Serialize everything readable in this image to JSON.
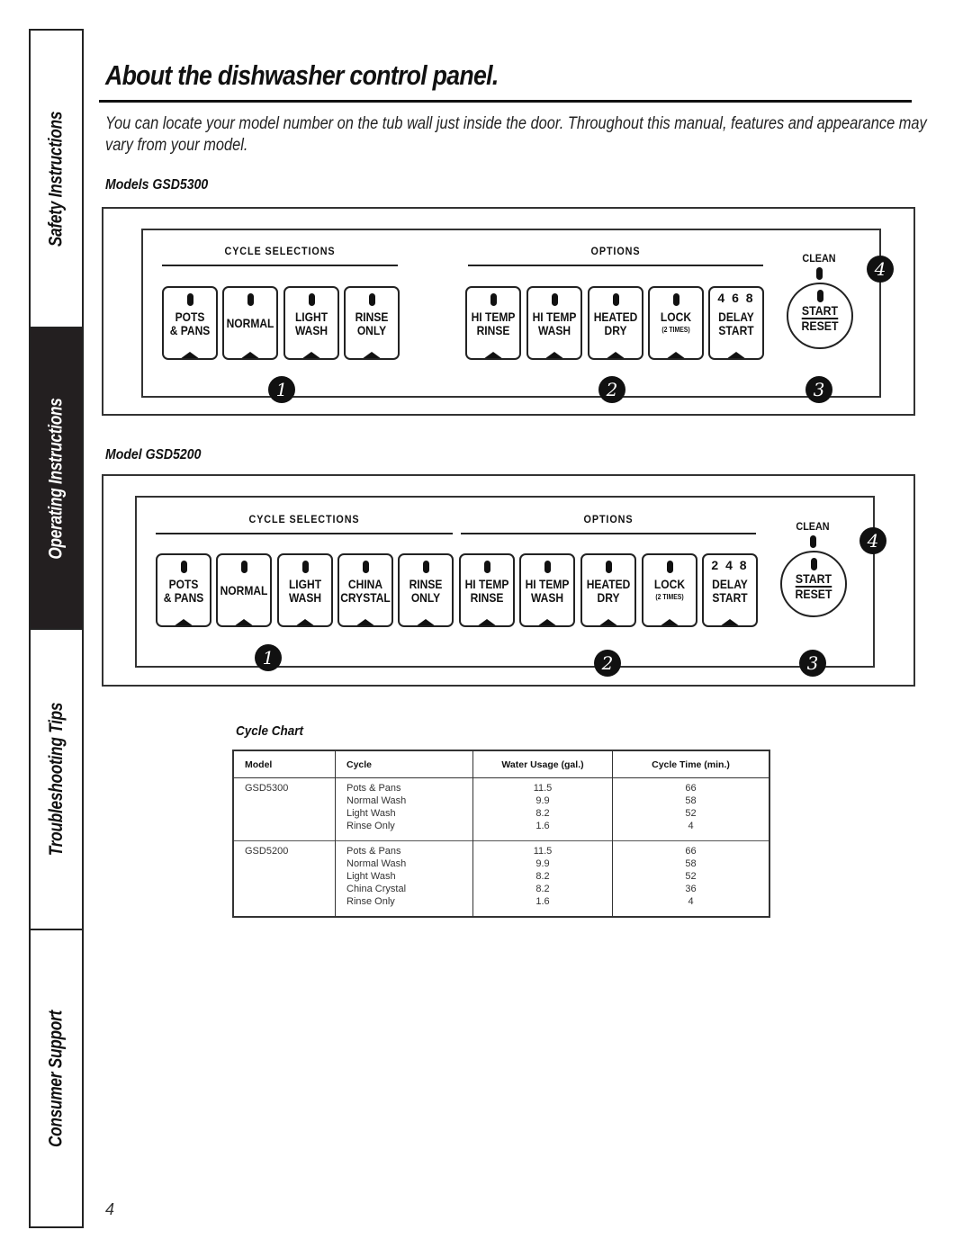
{
  "sidebar": {
    "tabs": [
      {
        "label": "Safety Instructions",
        "active": false
      },
      {
        "label": "Operating Instructions",
        "active": true
      },
      {
        "label": "Troubleshooting Tips",
        "active": false
      },
      {
        "label": "Consumer Support",
        "active": false
      }
    ]
  },
  "header": {
    "title": "About the dishwasher control panel.",
    "intro": "You can locate your model number on the tub wall just inside the door. Throughout this manual, features and appearance may vary from your model."
  },
  "panels": [
    {
      "heading": "Models GSD5300",
      "cycle_label": "CYCLE SELECTIONS",
      "options_label": "OPTIONS",
      "clean_label": "CLEAN",
      "cycle_keys": [
        {
          "line1": "POTS",
          "line2": "& PANS"
        },
        {
          "line1": "NORMAL",
          "line2": ""
        },
        {
          "line1": "LIGHT",
          "line2": "WASH"
        },
        {
          "line1": "RINSE",
          "line2": "ONLY"
        }
      ],
      "option_keys": [
        {
          "line1": "HI TEMP",
          "line2": "RINSE"
        },
        {
          "line1": "HI TEMP",
          "line2": "WASH"
        },
        {
          "line1": "HEATED",
          "line2": "DRY"
        },
        {
          "line1": "LOCK",
          "line2": "(2 TIMES)"
        },
        {
          "line1": "DELAY",
          "line2": "START",
          "hours": "4 6 8"
        }
      ],
      "start": {
        "line1": "START",
        "line2": "RESET"
      },
      "callouts": [
        "1",
        "2",
        "3",
        "4"
      ]
    },
    {
      "heading": "Model GSD5200",
      "cycle_label": "CYCLE SELECTIONS",
      "options_label": "OPTIONS",
      "clean_label": "CLEAN",
      "cycle_keys": [
        {
          "line1": "POTS",
          "line2": "& PANS"
        },
        {
          "line1": "NORMAL",
          "line2": ""
        },
        {
          "line1": "LIGHT",
          "line2": "WASH"
        },
        {
          "line1": "CHINA",
          "line2": "CRYSTAL"
        },
        {
          "line1": "RINSE",
          "line2": "ONLY"
        }
      ],
      "option_keys": [
        {
          "line1": "HI TEMP",
          "line2": "RINSE"
        },
        {
          "line1": "HI TEMP",
          "line2": "WASH"
        },
        {
          "line1": "HEATED",
          "line2": "DRY"
        },
        {
          "line1": "LOCK",
          "line2": "(2 TIMES)"
        },
        {
          "line1": "DELAY",
          "line2": "START",
          "hours": "2 4 8"
        }
      ],
      "start": {
        "line1": "START",
        "line2": "RESET"
      },
      "callouts": [
        "1",
        "2",
        "3",
        "4"
      ]
    }
  ],
  "cycle_chart": {
    "title": "Cycle Chart",
    "columns": [
      "Model",
      "Cycle",
      "Water Usage (gal.)",
      "Cycle Time (min.)"
    ],
    "groups": [
      {
        "model": "GSD5300",
        "rows": [
          {
            "cycle": "Pots & Pans",
            "water": "11.5",
            "time": "66"
          },
          {
            "cycle": "Normal Wash",
            "water": "9.9",
            "time": "58"
          },
          {
            "cycle": "Light Wash",
            "water": "8.2",
            "time": "52"
          },
          {
            "cycle": "Rinse Only",
            "water": "1.6",
            "time": "4"
          }
        ]
      },
      {
        "model": "GSD5200",
        "rows": [
          {
            "cycle": "Pots & Pans",
            "water": "11.5",
            "time": "66"
          },
          {
            "cycle": "Normal Wash",
            "water": "9.9",
            "time": "58"
          },
          {
            "cycle": "Light Wash",
            "water": "8.2",
            "time": "52"
          },
          {
            "cycle": "China Crystal",
            "water": "8.2",
            "time": "36"
          },
          {
            "cycle": "Rinse Only",
            "water": "1.6",
            "time": "4"
          }
        ]
      }
    ]
  },
  "page_number": "4"
}
